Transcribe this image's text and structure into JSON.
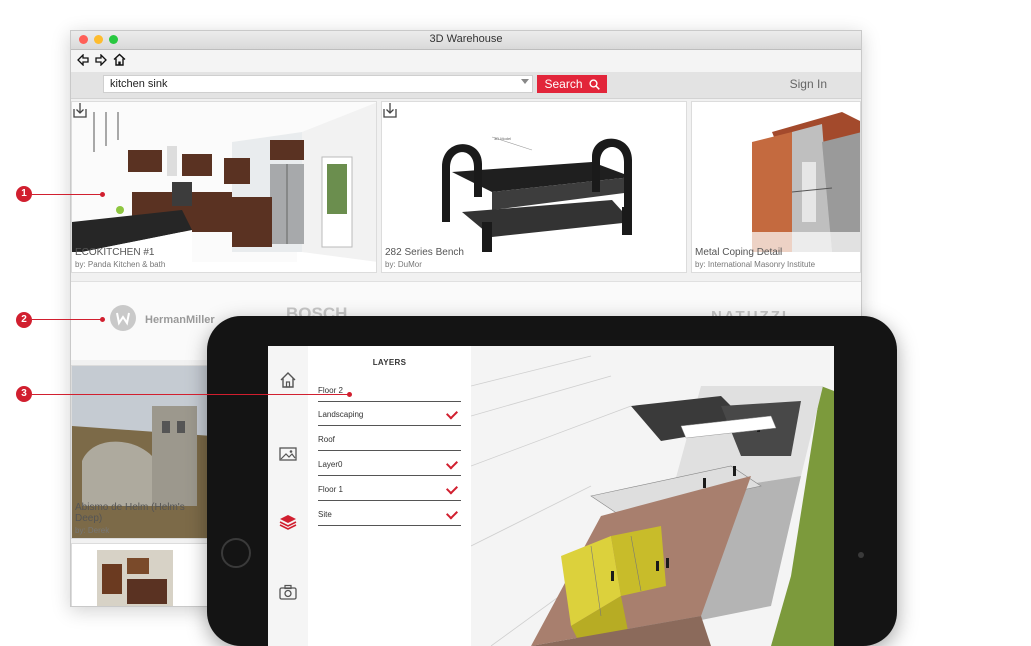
{
  "window": {
    "title": "3D Warehouse"
  },
  "search": {
    "value": "kitchen sink",
    "button_label": "Search"
  },
  "header": {
    "sign_in": "Sign In"
  },
  "models": [
    {
      "title": "ECOKITCHEN #1",
      "by": "by: Panda Kitchen & bath"
    },
    {
      "title": "282 Series Bench",
      "by": "by: DuMor"
    },
    {
      "title": "Metal Coping Detail",
      "by": "by: International Masonry Institute"
    }
  ],
  "models_row2": [
    {
      "title": "Abismo de Helm (Helm's Deep)",
      "by": "by: Derek"
    }
  ],
  "brands": [
    "HermanMiller",
    "BOSCH",
    "NATUZZI"
  ],
  "callouts": [
    "1",
    "2",
    "3"
  ],
  "layers_panel": {
    "title": "LAYERS",
    "items": [
      {
        "name": "Floor 2",
        "checked": false
      },
      {
        "name": "Landscaping",
        "checked": true
      },
      {
        "name": "Roof",
        "checked": false
      },
      {
        "name": "Layer0",
        "checked": true
      },
      {
        "name": "Floor 1",
        "checked": true
      },
      {
        "name": "Site",
        "checked": true
      }
    ]
  },
  "colors": {
    "accent": "#e2253a",
    "callout": "#d11f2f"
  },
  "icons": [
    "back-arrow-icon",
    "forward-arrow-icon",
    "home-icon",
    "search-icon",
    "download-icon",
    "image-icon",
    "layers-icon",
    "camera-icon"
  ]
}
